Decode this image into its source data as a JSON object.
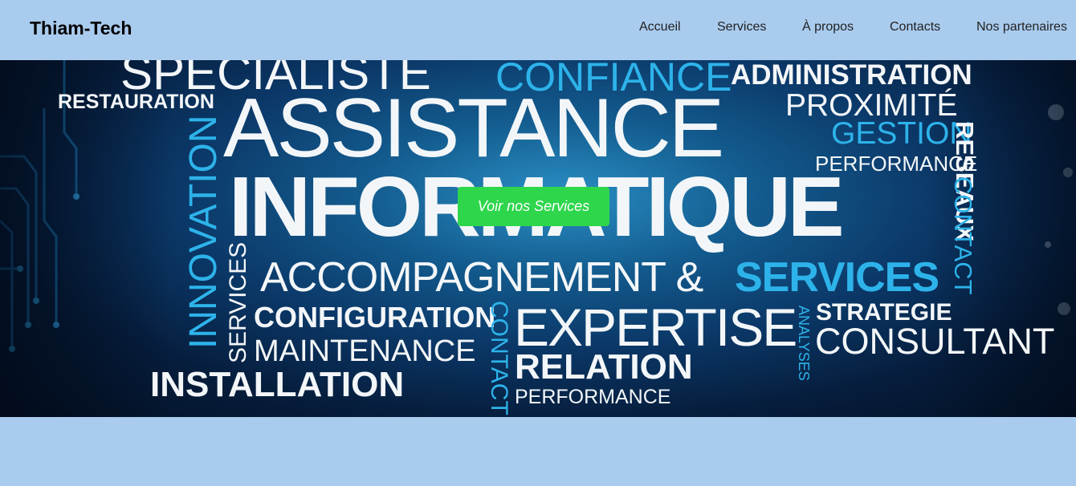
{
  "brand": {
    "name": "Thiam-Tech"
  },
  "nav": {
    "items": [
      "Accueil",
      "Services",
      "À propos",
      "Contacts",
      "Nos partenaires"
    ]
  },
  "hero": {
    "cta_label": "Voir nos Services",
    "words": {
      "specialiste": "SPECIALISTE",
      "confiance": "CONFIANCE",
      "administration": "ADMINISTRATION",
      "restauration": "RESTAURATION",
      "assistance": "ASSISTANCE",
      "proximite": "PROXIMITÉ",
      "gestion": "GESTION",
      "performance_top": "PERFORMANCE",
      "reseaux": "RESEAUX",
      "innovation": "INNOVATION",
      "informatique": "INFORMATIQUE",
      "contact_right": "CONTACT",
      "services_vertical": "SERVICES",
      "accompagnement": "ACCOMPAGNEMENT &",
      "services_blue": "SERVICES",
      "configuration": "CONFIGURATION",
      "contact_mid": "CONTACT",
      "expertise": "EXPERTISE",
      "analyses": "ANALYSES",
      "strategie": "STRATEGIE",
      "consultant": "CONSULTANT",
      "maintenance": "MAINTENANCE",
      "relation": "RELATION",
      "installation": "INSTALLATION",
      "performance_bottom": "PERFORMANCE"
    }
  },
  "colors": {
    "page_bg": "#a9cbee",
    "cta_green": "#2ed64c",
    "word_cyan": "#2db3ea",
    "word_white": "#f3f6f8"
  }
}
